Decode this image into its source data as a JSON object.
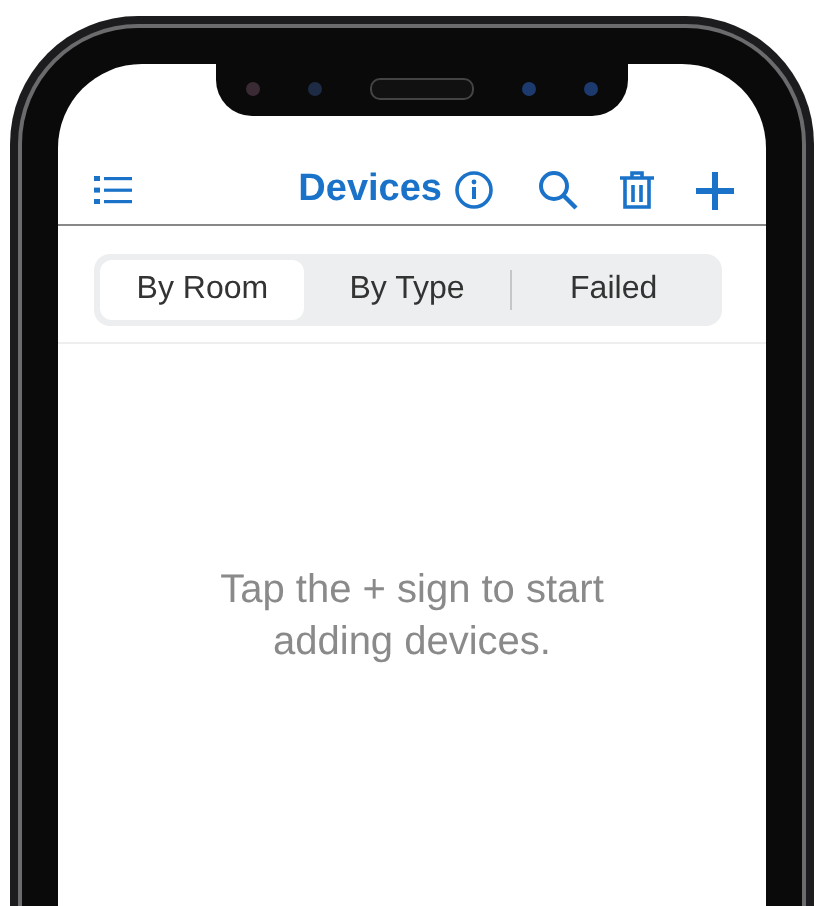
{
  "header": {
    "title": "Devices"
  },
  "segments": [
    {
      "label": "By Room",
      "selected": true
    },
    {
      "label": "By Type",
      "selected": false
    },
    {
      "label": "Failed",
      "selected": false
    }
  ],
  "empty_message": "Tap the + sign to start adding devices."
}
